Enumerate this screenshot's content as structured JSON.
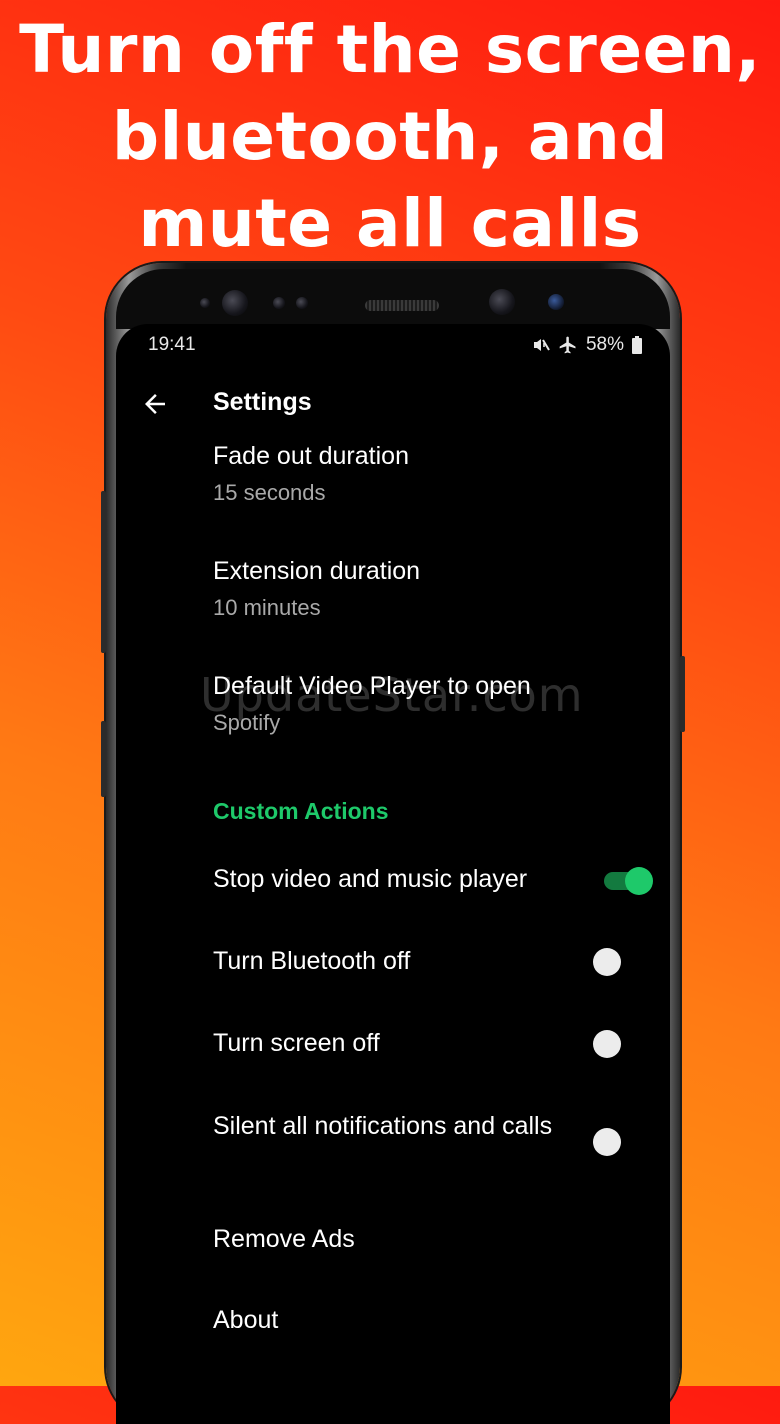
{
  "promo": {
    "line1": "Turn off the screen,",
    "line2": "bluetooth, and",
    "line3": "mute all calls"
  },
  "status_bar": {
    "time": "19:41",
    "battery": "58%",
    "icons": [
      "mute-icon",
      "airplane-icon",
      "battery-icon"
    ]
  },
  "app_bar": {
    "title": "Settings",
    "back_icon": "arrow-left-icon"
  },
  "settings": {
    "fade_out": {
      "title": "Fade out duration",
      "value": "15 seconds"
    },
    "extension": {
      "title": "Extension duration",
      "value": "10 minutes"
    },
    "default_player": {
      "title": "Default Video Player to open",
      "value": "Spotify"
    },
    "custom_actions": {
      "header": "Custom Actions",
      "items": [
        {
          "label": "Stop video and music player",
          "enabled": true
        },
        {
          "label": "Turn Bluetooth off",
          "enabled": false
        },
        {
          "label": "Turn screen off",
          "enabled": false
        },
        {
          "label": "Silent all notifications and calls",
          "enabled": false
        }
      ]
    },
    "remove_ads": "Remove Ads",
    "about": "About"
  },
  "watermark": "UpdateStar.com",
  "colors": {
    "accent": "#1ec96a",
    "switch_on_track": "#137a3f",
    "switch_off_thumb": "#ececec",
    "switch_off_track": "#3a3a3a",
    "background": "#000000",
    "secondary_text": "#a9a9a9"
  }
}
